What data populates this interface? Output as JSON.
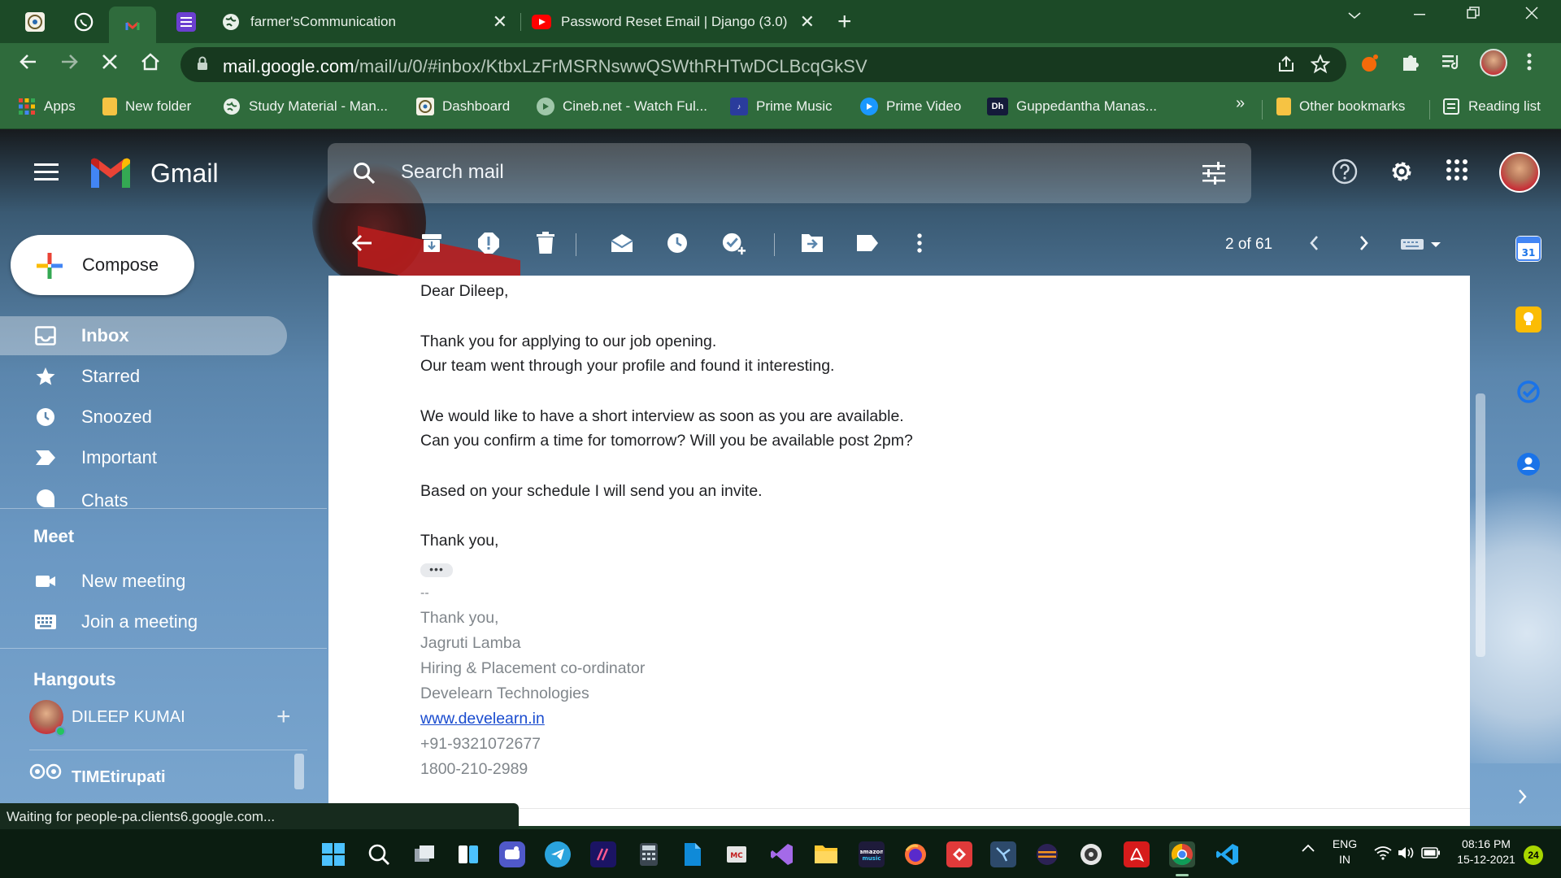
{
  "browser": {
    "tabs": [
      {
        "title": "farmer'sCommunication",
        "close": "✕"
      },
      {
        "title": "Password Reset Email | Django (3.0)",
        "close": "✕"
      }
    ],
    "new_tab": "+",
    "url_host": "mail.google.com",
    "url_path": "/mail/u/0/#inbox/KtbxLzFrMSRNswwQSWthRHTwDCLBcqGkSV",
    "bookmarks": [
      "Apps",
      "New folder",
      "Study Material - Man...",
      "Dashboard",
      "Cineb.net - Watch Ful...",
      "Prime Music",
      "Prime Video",
      "Guppedantha Manas..."
    ],
    "bookmarks_more": "»",
    "other_bookmarks": "Other bookmarks",
    "reading_list": "Reading list",
    "status_text": "Waiting for people-pa.clients6.google.com..."
  },
  "gmail": {
    "product_name": "Gmail",
    "search_placeholder": "Search mail",
    "compose_label": "Compose",
    "nav": [
      {
        "label": "Inbox",
        "icon": "inbox-icon",
        "active": true
      },
      {
        "label": "Starred",
        "icon": "star-icon"
      },
      {
        "label": "Snoozed",
        "icon": "clock-icon"
      },
      {
        "label": "Important",
        "icon": "important-icon"
      },
      {
        "label": "Chats",
        "icon": "chat-icon"
      }
    ],
    "meet": {
      "heading": "Meet",
      "items": [
        {
          "label": "New meeting",
          "icon": "video-camera-icon"
        },
        {
          "label": "Join a meeting",
          "icon": "keyboard-icon"
        }
      ]
    },
    "hangouts": {
      "heading": "Hangouts",
      "user": "DILEEP KUMAI",
      "add": "+",
      "contact": "TIMEtirupati"
    },
    "pager": "2 of 61",
    "calendar_day": "31",
    "message": {
      "greeting": "Dear Dileep,",
      "p1_l1": "Thank you for applying to our job opening.",
      "p1_l2": "Our team went through your profile and found it interesting.",
      "p2_l1": "We would like to have a short interview as soon as you are available.",
      "p2_l2": "Can you confirm a time for tomorrow? Will you be available post 2pm?",
      "p3": "Based on your schedule I will send you an invite.",
      "closing": "Thank you,",
      "trimmed": "•••",
      "sig_dash": "--",
      "sig_thanks": "Thank you,",
      "sig_name": "Jagruti Lamba",
      "sig_title": "Hiring & Placement co-ordinator",
      "sig_company": "Develearn Technologies",
      "sig_url": "www.develearn.in",
      "sig_phone1": "+91-9321072677",
      "sig_phone2": "1800-210-2989"
    }
  },
  "taskbar": {
    "lang_top": "ENG",
    "lang_bottom": "IN",
    "time": "08:16 PM",
    "date": "15-12-2021",
    "notifications": "24"
  },
  "colors": {
    "chrome_frame": "#1c4a27",
    "chrome_toolbar": "#2f6b3c",
    "link": "#1a4ccf",
    "signature_gray": "#80868b"
  }
}
